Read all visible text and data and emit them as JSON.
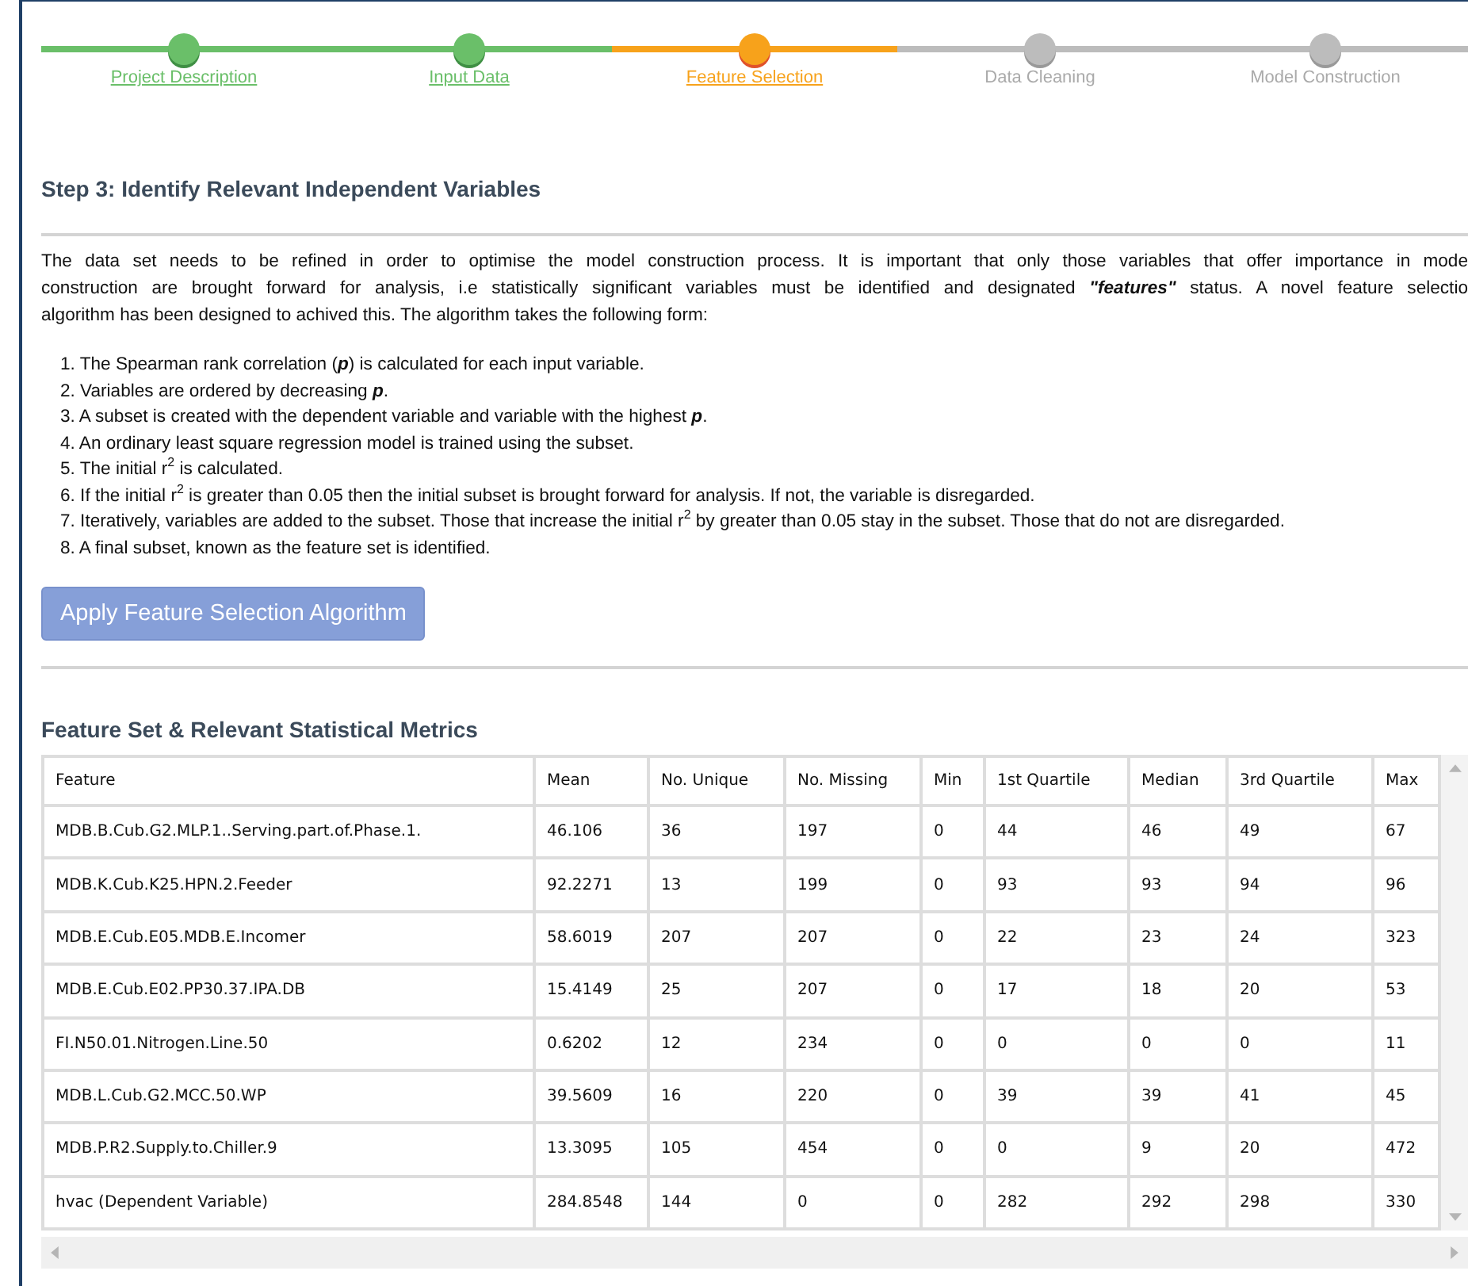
{
  "steps": [
    {
      "label": "Project Description",
      "completed": true,
      "selected": false
    },
    {
      "label": "Input Data",
      "completed": true,
      "selected": false
    },
    {
      "label": "Feature Selection",
      "completed": false,
      "selected": true
    },
    {
      "label": "Data Cleaning",
      "completed": false,
      "selected": false
    },
    {
      "label": "Model Construction",
      "completed": false,
      "selected": false
    }
  ],
  "heading": "Step 3: Identify Relevant Independent Variables",
  "intro_lines": [
    "The data set needs to be refined in order to optimise the model construction process. It is important that only those variables that offer importance in mode",
    "construction are brought forward for analysis, i.e statistically significant variables must be identified and designated **\"features\"** status. A novel feature selectio",
    "algorithm has been designed to achived this. The algorithm takes the following form:"
  ],
  "algorithm_steps": [
    "1. The Spearman rank correlation (**p**) is calculated for each input variable.",
    "2. Variables are ordered by decreasing **p**.",
    "3. A subset is created with the dependent variable and variable with the highest **p**.",
    "4. An ordinary least square regression model is trained using the subset.",
    "5. The initial r$^{2}$ is calculated.",
    "6. If the initial r$^{2}$ is greater than 0.05 then the initial subset is brought forward for analysis. If not, the variable is disregarded.",
    "7. Iteratively, variables are added to the subset. Those that increase the initial r$^{2}$ by greater than 0.05 stay in the subset. Those that do not are disregarded.",
    "8. A final subset, known as the feature set is identified."
  ],
  "apply_button": "Apply Feature Selection Algorithm",
  "table_title": "Feature Set & Relevant Statistical Metrics",
  "table": {
    "columns": [
      "Feature",
      "Mean",
      "No. Unique",
      "No. Missing",
      "Min",
      "1st Quartile",
      "Median",
      "3rd Quartile",
      "Max"
    ],
    "rows": [
      [
        "MDB.B.Cub.G2.MLP.1..Serving.part.of.Phase.1.",
        "46.106",
        "36",
        "197",
        "0",
        "44",
        "46",
        "49",
        "67"
      ],
      [
        "MDB.K.Cub.K25.HPN.2.Feeder",
        "92.2271",
        "13",
        "199",
        "0",
        "93",
        "93",
        "94",
        "96"
      ],
      [
        "MDB.E.Cub.E05.MDB.E.Incomer",
        "58.6019",
        "207",
        "207",
        "0",
        "22",
        "23",
        "24",
        "323"
      ],
      [
        "MDB.E.Cub.E02.PP30.37.IPA.DB",
        "15.4149",
        "25",
        "207",
        "0",
        "17",
        "18",
        "20",
        "53"
      ],
      [
        "FI.N50.01.Nitrogen.Line.50",
        "0.6202",
        "12",
        "234",
        "0",
        "0",
        "0",
        "0",
        "11"
      ],
      [
        "MDB.L.Cub.G2.MCC.50.WP",
        "39.5609",
        "16",
        "220",
        "0",
        "39",
        "39",
        "41",
        "45"
      ],
      [
        "MDB.P.R2.Supply.to.Chiller.9",
        "13.3095",
        "105",
        "454",
        "0",
        "0",
        "9",
        "20",
        "472"
      ],
      [
        "hvac (Dependent Variable)",
        "284.8548",
        "144",
        "0",
        "0",
        "282",
        "292",
        "298",
        "330"
      ]
    ]
  }
}
